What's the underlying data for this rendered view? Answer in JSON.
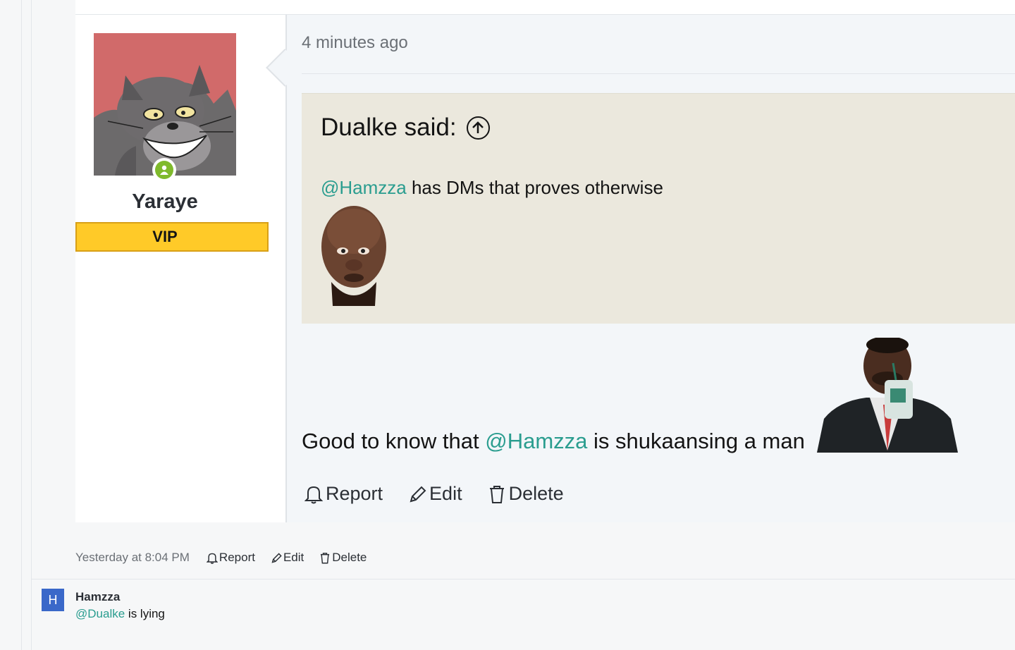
{
  "post": {
    "user": {
      "name": "Yaraye",
      "badge": "VIP",
      "online": true
    },
    "time": "4 minutes ago",
    "quote": {
      "author_label": "Dualke said:",
      "mention": "@Hamzza",
      "text": " has DMs that proves otherwise"
    },
    "body": {
      "prefix": "Good to know that ",
      "mention": "@Hamzza",
      "suffix": " is shukaansing a man"
    },
    "actions": {
      "report": "Report",
      "edit": "Edit",
      "delete": "Delete"
    }
  },
  "post_meta": {
    "date": "Yesterday at 8:04 PM",
    "report": "Report",
    "edit": "Edit",
    "delete": "Delete"
  },
  "comment": {
    "avatar_letter": "H",
    "author": "Hamzza",
    "mention": "@Dualke",
    "text": " is lying"
  },
  "colors": {
    "mention": "#2a9d8f",
    "vip": "#ffca28",
    "online": "#7fba2c",
    "avatar_bg": "#3a68c9"
  }
}
